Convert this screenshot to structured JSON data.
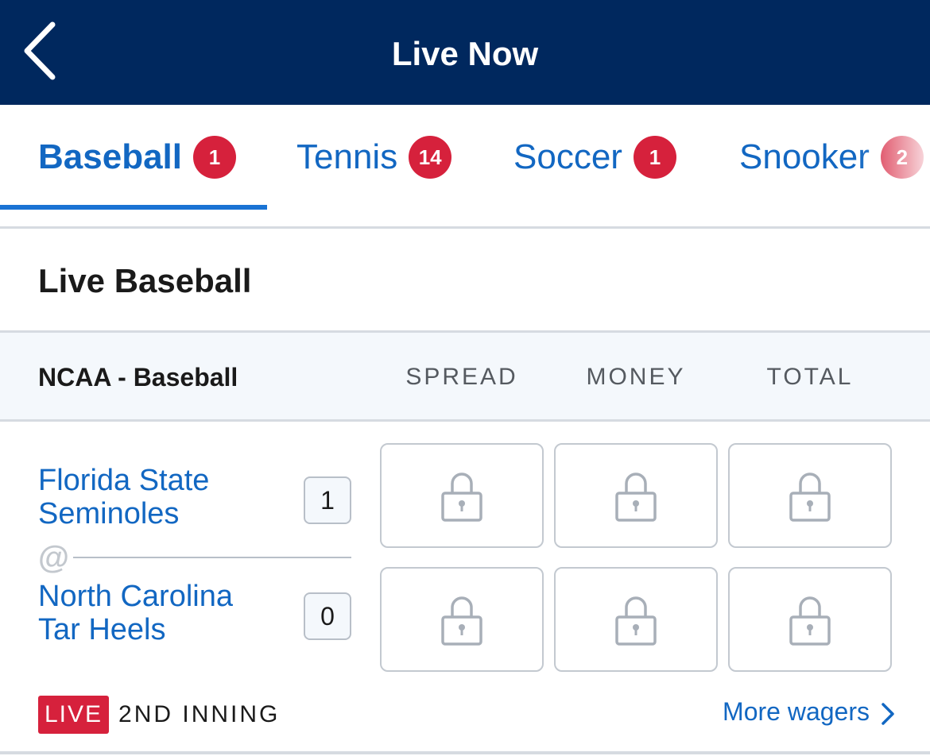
{
  "header": {
    "title": "Live Now",
    "back_icon": "chevron-left-icon",
    "background": "#00285e"
  },
  "tabs": [
    {
      "label": "Baseball",
      "count": "1",
      "active": true
    },
    {
      "label": "Tennis",
      "count": "14",
      "active": false
    },
    {
      "label": "Soccer",
      "count": "1",
      "active": false
    },
    {
      "label": "Snooker",
      "count": "2",
      "active": false
    }
  ],
  "section": {
    "title": "Live Baseball"
  },
  "league": {
    "name": "NCAA - Baseball",
    "columns": [
      "SPREAD",
      "MONEY",
      "TOTAL"
    ]
  },
  "event": {
    "teams": [
      {
        "name_line1": "Florida State",
        "name_line2": "Seminoles",
        "score": "1"
      },
      {
        "name_line1": "North Carolina",
        "name_line2": "Tar Heels",
        "score": "0"
      }
    ],
    "separator": "@",
    "odds_icon": "lock-icon",
    "status": {
      "live_label": "LIVE",
      "period": "2ND INNING"
    },
    "more_wagers_label": "More wagers"
  },
  "colors": {
    "accent": "#1267c2",
    "badge": "#d6213c",
    "header": "#00285e"
  }
}
